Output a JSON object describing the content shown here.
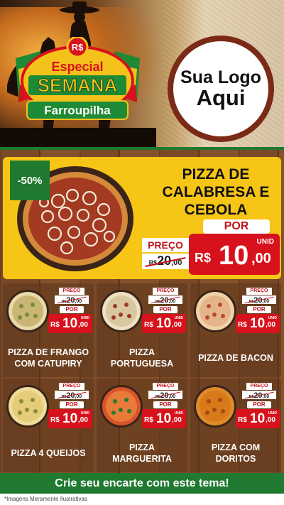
{
  "header": {
    "badge": {
      "line1": "Especial",
      "line2": "SEMANA",
      "line3": "Farroupilha",
      "currency": "R$"
    },
    "logo": {
      "line1": "Sua Logo",
      "line2": "Aqui"
    }
  },
  "hero": {
    "discount": "-50%",
    "title_l1": "PIZZA DE",
    "title_l2": "CALABRESA E",
    "title_l3": "CEBOLA",
    "price_label": "PREÇO",
    "old_rs": "R$",
    "old_whole": "20",
    "old_cents": ",00",
    "por_label": "POR",
    "unid_label": "UNID",
    "new_rs": "R$",
    "new_whole": "10",
    "new_cents": ",00"
  },
  "products": [
    {
      "name_l1": "PIZZA DE FRANGO",
      "name_l2": "COM CATUPIRY",
      "price_label": "PREÇO",
      "old_rs": "R$",
      "old_whole": "20",
      "old_cents": ",00",
      "por_label": "POR",
      "unid_label": "UNID",
      "new_rs": "R$",
      "new_whole": "10",
      "new_cents": ",00"
    },
    {
      "name_l1": "PIZZA",
      "name_l2": "PORTUGUESA",
      "price_label": "PREÇO",
      "old_rs": "R$",
      "old_whole": "20",
      "old_cents": ",00",
      "por_label": "POR",
      "unid_label": "UNID",
      "new_rs": "R$",
      "new_whole": "10",
      "new_cents": ",00"
    },
    {
      "name_l1": "PIZZA DE BACON",
      "name_l2": "",
      "price_label": "PREÇO",
      "old_rs": "R$",
      "old_whole": "20",
      "old_cents": ",00",
      "por_label": "POR",
      "unid_label": "UNID",
      "new_rs": "R$",
      "new_whole": "10",
      "new_cents": ",00"
    },
    {
      "name_l1": "PIZZA 4 QUEIJOS",
      "name_l2": "",
      "price_label": "PREÇO",
      "old_rs": "R$",
      "old_whole": "20",
      "old_cents": ",00",
      "por_label": "POR",
      "unid_label": "UNID",
      "new_rs": "R$",
      "new_whole": "10",
      "new_cents": ",00"
    },
    {
      "name_l1": "PIZZA",
      "name_l2": "MARGUERITA",
      "price_label": "PREÇO",
      "old_rs": "R$",
      "old_whole": "20",
      "old_cents": ",00",
      "por_label": "POR",
      "unid_label": "UNID",
      "new_rs": "R$",
      "new_whole": "10",
      "new_cents": ",00"
    },
    {
      "name_l1": "PIZZA COM",
      "name_l2": "DORITOS",
      "price_label": "PREÇO",
      "old_rs": "R$",
      "old_whole": "20",
      "old_cents": ",00",
      "por_label": "POR",
      "unid_label": "UNID",
      "new_rs": "R$",
      "new_whole": "10",
      "new_cents": ",00"
    }
  ],
  "cta": "Crie seu encarte com este tema!",
  "footer_note": "*Imagens Meramente Ilustrativas",
  "colors": {
    "green": "#1f7a2f",
    "red": "#d7121c",
    "yellow": "#f6c515",
    "wood": "#6b4023"
  }
}
